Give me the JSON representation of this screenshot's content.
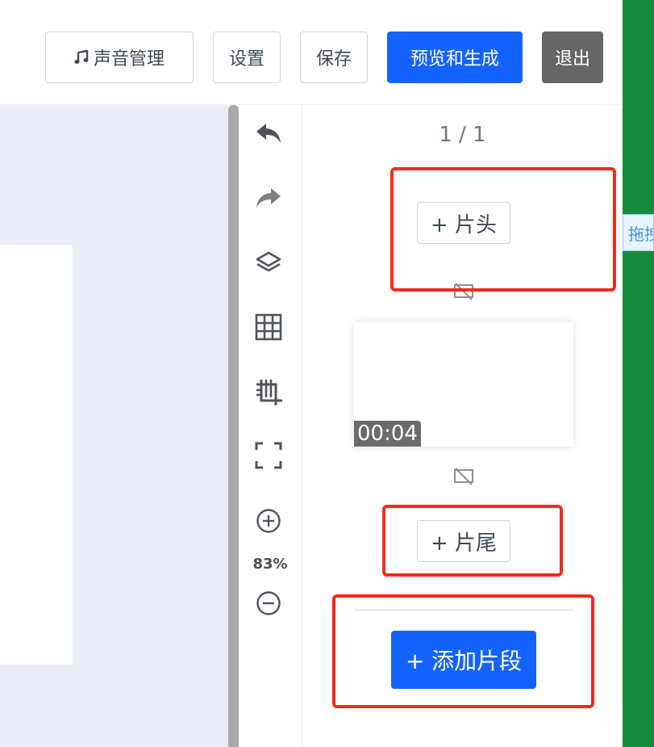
{
  "header": {
    "sound_label": "声音管理",
    "settings_label": "设置",
    "save_label": "保存",
    "preview_label": "预览和生成",
    "exit_label": "退出"
  },
  "toolbar": {
    "zoom_level": "83%",
    "icons": [
      "undo-icon",
      "redo-icon",
      "layers-icon",
      "grid-icon",
      "crop-icon",
      "fullscreen-icon",
      "zoom-in-icon",
      "zoom-out-icon"
    ]
  },
  "panel": {
    "pager": "1 / 1",
    "intro_label": "+ 片头",
    "outro_label": "+ 片尾",
    "clip_duration": "00:04",
    "add_segment_label": "+ 添加片段"
  },
  "side": {
    "drag_tag": "拖拽"
  },
  "colors": {
    "primary": "#1463ff",
    "highlight": "#f22a1e",
    "strip": "#17893b",
    "canvas_bg": "#ebeef7"
  }
}
